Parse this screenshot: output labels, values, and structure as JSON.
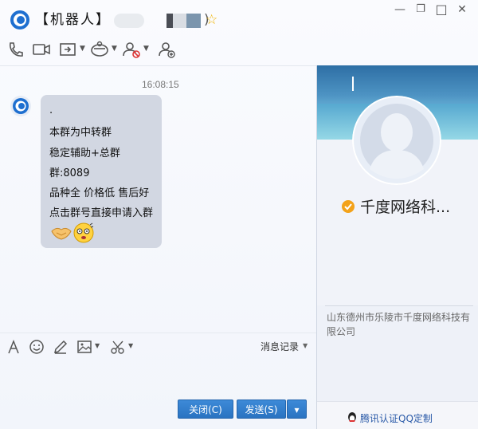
{
  "window": {
    "title": "【机器人】",
    "title_tail": ")",
    "controls": {
      "minimize": "—",
      "maximize": "□",
      "close": "✕"
    }
  },
  "toolbar": {
    "icons": [
      "phone-icon",
      "video-icon",
      "share-screen-icon",
      "remote-assist-icon",
      "block-user-icon",
      "add-contact-icon"
    ]
  },
  "chat": {
    "timestamp": "16:08:15",
    "lines": [
      ".",
      "本群为中转群",
      "稳定辅助+总群",
      "群:8089",
      "品种全 价格低 售后好",
      "点击群号直接申请入群"
    ],
    "emojis": [
      "handshake-emoji",
      "dizzy-face-emoji"
    ]
  },
  "input": {
    "history_label": "消息记录",
    "close_button": "关闭(C)",
    "send_button": "发送(S)"
  },
  "profile": {
    "name": "千度网络科...",
    "address": "山东德州市乐陵市千度网络科技有限公司",
    "cert_label": "腾讯认证QQ定制"
  },
  "colors": {
    "accent": "#2a73c1",
    "bubble": "#d2d7e2",
    "banner": "#4d93c3"
  }
}
